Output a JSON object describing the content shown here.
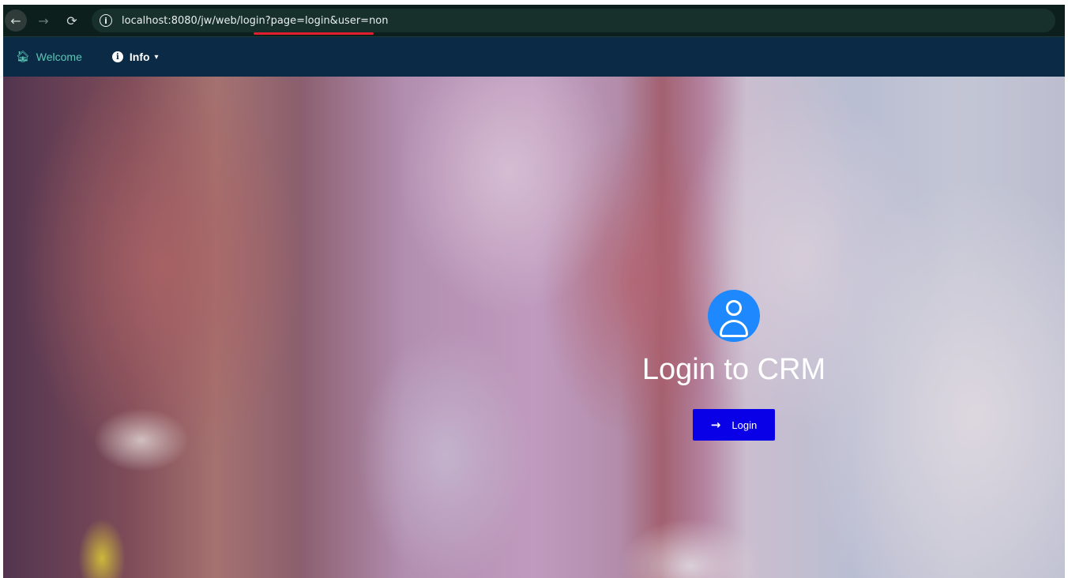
{
  "browser": {
    "back_icon": "←",
    "forward_icon": "→",
    "reload_icon": "⟳",
    "site_info_icon": "i",
    "url": "localhost:8080/jw/web/login?page=login&user=non",
    "highlight_color": "#e11d2e"
  },
  "nav": {
    "welcome_icon": "home-icon",
    "welcome_label": "Welcome",
    "info_icon": "info-circle-icon",
    "info_label": "Info",
    "info_chevron": "⌄",
    "background": "#0b2a45",
    "welcome_color": "#5cc7b6"
  },
  "login": {
    "avatar_icon": "user-avatar-icon",
    "avatar_color": "#1e88ff",
    "title": "Login to CRM",
    "button_label": "Login",
    "button_icon": "arrow-right-icon",
    "button_color": "#0a00e8"
  }
}
